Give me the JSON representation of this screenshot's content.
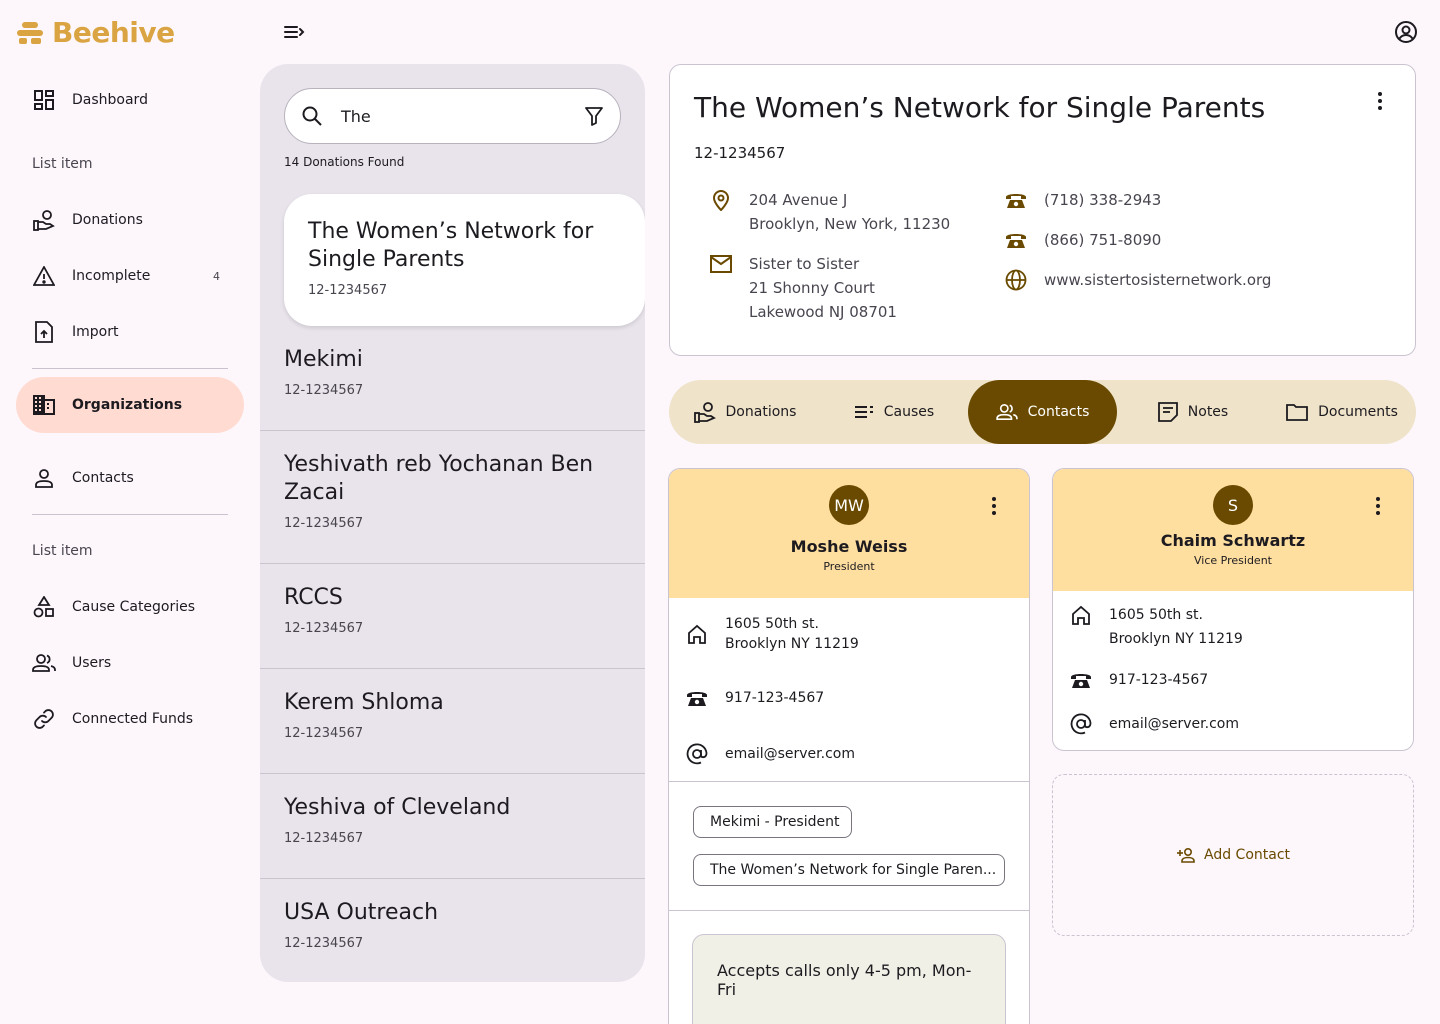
{
  "app": {
    "name": "Beehive"
  },
  "sidebar": {
    "items": [
      {
        "label": "Dashboard"
      },
      {
        "label": "Donations"
      },
      {
        "label": "Incomplete",
        "badge": "4"
      },
      {
        "label": "Import"
      },
      {
        "label": "Organizations"
      },
      {
        "label": "Contacts"
      },
      {
        "label": "Cause Categories"
      },
      {
        "label": "Users"
      },
      {
        "label": "Connected Funds"
      }
    ],
    "section_labels": [
      "List item",
      "List item"
    ]
  },
  "search": {
    "value": "The",
    "results_text": "14 Donations Found"
  },
  "organizations": [
    {
      "name": "The Women’s Network for Single Parents",
      "id": "12-1234567"
    },
    {
      "name": "Mekimi",
      "id": "12-1234567"
    },
    {
      "name": "Yeshivath reb Yochanan Ben Zacai",
      "id": "12-1234567"
    },
    {
      "name": "RCCS",
      "id": "12-1234567"
    },
    {
      "name": "Kerem Shloma",
      "id": "12-1234567"
    },
    {
      "name": "Yeshiva of Cleveland",
      "id": "12-1234567"
    },
    {
      "name": "USA Outreach",
      "id": "12-1234567"
    }
  ],
  "detail": {
    "title": "The Women’s Network for Single Parents",
    "id": "12-1234567",
    "address_line1": "204 Avenue J",
    "address_line2": "Brooklyn, New York, 11230",
    "mail_line1": "Sister to Sister",
    "mail_line2": "21 Shonny Court",
    "mail_line3": "Lakewood NJ 08701",
    "phone1": "(718) 338-2943",
    "phone2": "(866) 751-8090",
    "website": "www.sistertosisternetwork.org"
  },
  "tabs": [
    {
      "label": "Donations"
    },
    {
      "label": "Causes"
    },
    {
      "label": "Contacts"
    },
    {
      "label": "Notes"
    },
    {
      "label": "Documents"
    }
  ],
  "contacts": [
    {
      "initials": "MW",
      "name": "Moshe Weiss",
      "role": "President",
      "address_line1": "1605 50th st.",
      "address_line2": "Brooklyn NY 11219",
      "phone": "917-123-4567",
      "email": "email@server.com",
      "chips": [
        "Mekimi - President",
        "The Women’s Network for Single Paren..."
      ],
      "note": "Accepts calls only 4-5 pm, Mon-Fri"
    },
    {
      "initials": "S",
      "name": "Chaim Schwartz",
      "role": "Vice President",
      "address_line1": "1605 50th st.",
      "address_line2": "Brooklyn NY 11219",
      "phone": "917-123-4567",
      "email": "email@server.com"
    }
  ],
  "add_contact": {
    "label": "Add Contact"
  },
  "colors": {
    "brand": "#d9a441",
    "accent": "#6a4a00",
    "selected_nav": "#ffdbd1",
    "contact_header": "#ffdfa0"
  }
}
